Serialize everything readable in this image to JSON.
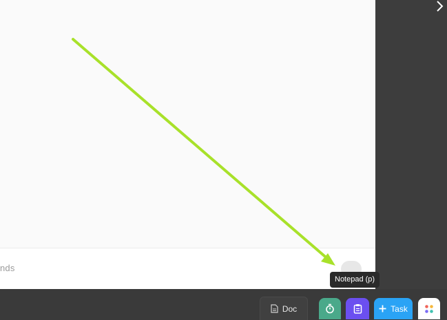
{
  "command_bar": {
    "placeholder_fragment": "nds"
  },
  "tooltip": {
    "text": "Notepad (p)"
  },
  "bottom_bar": {
    "doc_label": "Doc",
    "task_label": "Task"
  },
  "icons": {
    "panel_toggle": "chevron-right-icon",
    "doc": "document-icon",
    "timer": "stopwatch-icon",
    "notepad": "clipboard-icon",
    "task": "plus-icon",
    "apps": "apps-grid-icon"
  },
  "colors": {
    "annotation_arrow": "#a8e12a",
    "timer_button": "#4aa98a",
    "notepad_button": "#6b4ff0",
    "task_button": "#2aa3f5"
  }
}
